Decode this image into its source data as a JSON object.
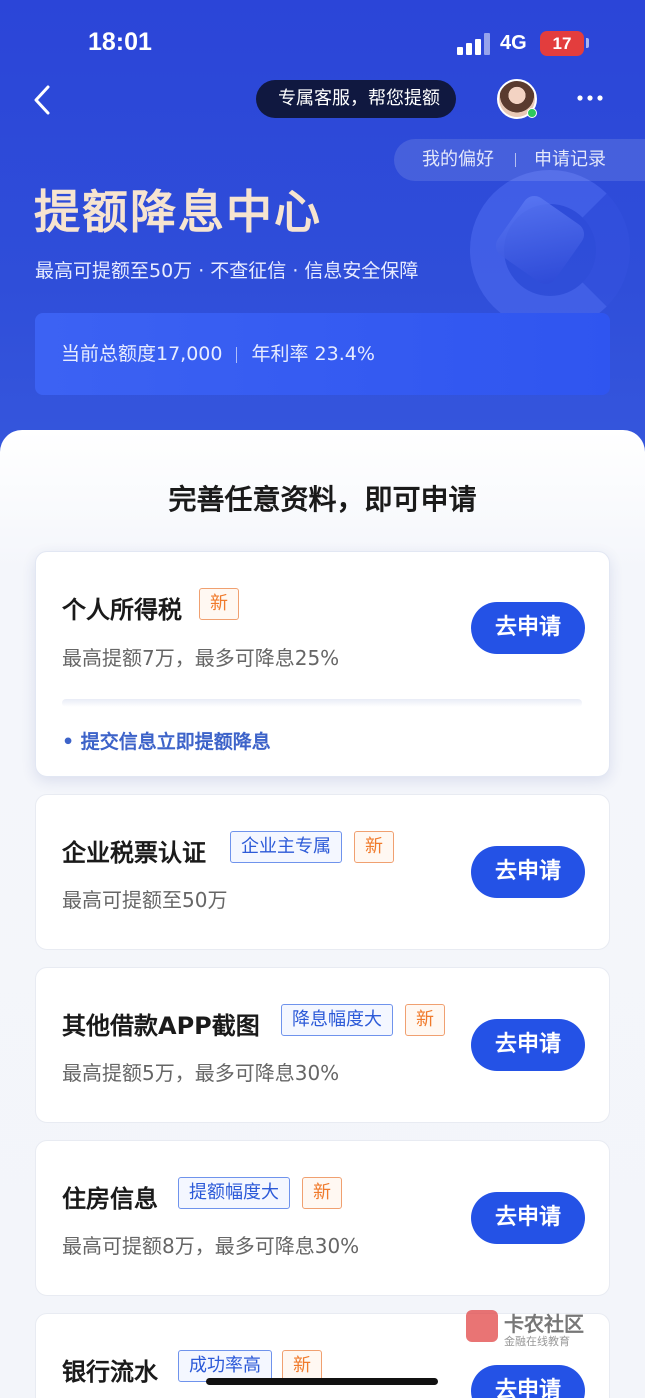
{
  "status_bar": {
    "time": "18:01",
    "network": "4G",
    "battery": "17"
  },
  "header": {
    "service_text": "专属客服，帮您提额",
    "preference_label": "我的偏好",
    "records_label": "申请记录"
  },
  "hero": {
    "title": "提额降息中心",
    "subtitle": "最高可提额至50万 · 不查征信 · 信息安全保障",
    "quota_text": "当前总额度17,000",
    "rate_text": "年利率 23.4%"
  },
  "section_title": "完善任意资料，即可申请",
  "cards": [
    {
      "title": "个人所得税",
      "tags": [
        "新"
      ],
      "desc": "最高提额7万，最多可降息25%",
      "hint": "• 提交信息立即提额降息",
      "button": "去申请"
    },
    {
      "title": "企业税票认证",
      "tags": [
        "企业主专属",
        "新"
      ],
      "desc": "最高可提额至50万",
      "button": "去申请"
    },
    {
      "title": "其他借款APP截图",
      "tags": [
        "降息幅度大",
        "新"
      ],
      "desc": "最高提额5万，最多可降息30%",
      "button": "去申请"
    },
    {
      "title": "住房信息",
      "tags": [
        "提额幅度大",
        "新"
      ],
      "desc": "最高可提额8万，最多可降息30%",
      "button": "去申请"
    },
    {
      "title": "银行流水",
      "tags": [
        "成功率高",
        "新"
      ],
      "button": "去申请"
    }
  ],
  "watermark": {
    "name": "卡农社区",
    "sub": "金融在线教育"
  }
}
